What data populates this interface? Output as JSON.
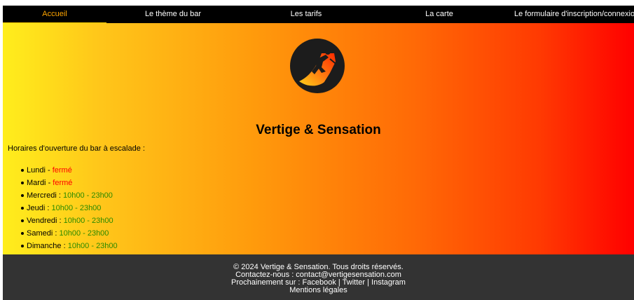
{
  "nav": {
    "items": [
      {
        "label": "Accueil"
      },
      {
        "label": "Le thème du bar"
      },
      {
        "label": "Les tarifs"
      },
      {
        "label": "La carte"
      },
      {
        "label": "Le formulaire d'inscription/connexion"
      }
    ]
  },
  "hero": {
    "logo_icon": "climber-icon",
    "title": "Vertige & Sensation"
  },
  "hours": {
    "intro": "Horaires d'ouverture du bar à escalade :",
    "days": [
      {
        "day": "Lundi",
        "sep": " - ",
        "value": "fermé",
        "status": "closed"
      },
      {
        "day": "Mardi",
        "sep": " - ",
        "value": "fermé",
        "status": "closed"
      },
      {
        "day": "Mercredi",
        "sep": " : ",
        "value": "10h00 - 23h00",
        "status": "open"
      },
      {
        "day": "Jeudi",
        "sep": " : ",
        "value": "10h00 - 23h00",
        "status": "open"
      },
      {
        "day": "Vendredi",
        "sep": " : ",
        "value": "10h00 - 23h00",
        "status": "open"
      },
      {
        "day": "Samedi",
        "sep": " : ",
        "value": "10h00 - 23h00",
        "status": "open"
      },
      {
        "day": "Dimanche",
        "sep": " : ",
        "value": "10h00 - 23h00",
        "status": "open"
      }
    ]
  },
  "footer": {
    "copyright": "© 2024 Vertige & Sensation. Tous droits réservés.",
    "contact": "Contactez-nous : contact@vertigesensation.com",
    "social_prefix": "Prochainement sur : ",
    "facebook": "Facebook",
    "sep": " | ",
    "twitter": "Twitter",
    "instagram": "Instagram",
    "legal": "Mentions légales"
  },
  "colors": {
    "nav_bg": "#000000",
    "nav_active": "#ffa500",
    "closed": "#ff0000",
    "open": "#2a8a00",
    "footer_bg": "#333333"
  }
}
